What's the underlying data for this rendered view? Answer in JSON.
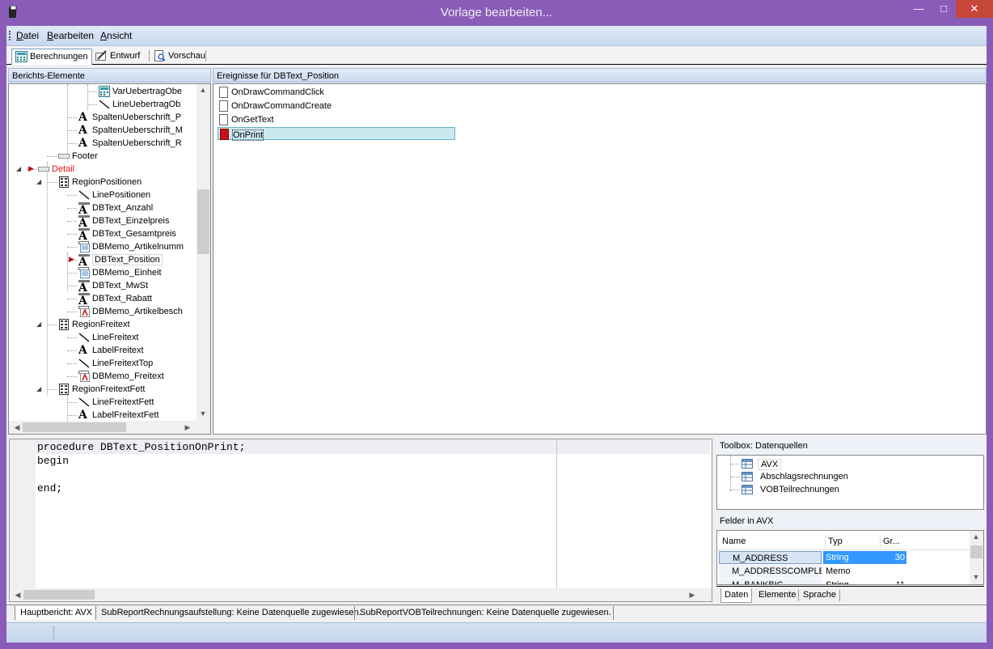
{
  "window": {
    "title": "Vorlage bearbeiten..."
  },
  "menu": [
    "Datei",
    "Bearbeiten",
    "Ansicht"
  ],
  "tabs": [
    {
      "label": "Berechnungen",
      "icon": "calculator-icon",
      "active": true
    },
    {
      "label": "Entwurf",
      "icon": "pencil-icon",
      "active": false
    },
    {
      "label": "Vorschau",
      "icon": "preview-icon",
      "active": false
    }
  ],
  "left_panel": {
    "header": "Berichts-Elemente",
    "tree": [
      {
        "label": "VarUebertragObe",
        "icon": "calc-icon",
        "level": 5
      },
      {
        "label": "LineUebertragOb",
        "icon": "line-icon",
        "level": 5
      },
      {
        "label": "SpaltenUeberschrift_P",
        "icon": "label-icon",
        "level": 4
      },
      {
        "label": "SpaltenUeberschrift_M",
        "icon": "label-icon",
        "level": 4
      },
      {
        "label": "SpaltenUeberschrift_R",
        "icon": "label-icon",
        "level": 4
      },
      {
        "label": "Footer",
        "icon": "band-icon",
        "level": 3
      },
      {
        "label": "Detail",
        "icon": "band-icon",
        "level": 2,
        "highlight": true
      },
      {
        "label": "RegionPositionen",
        "icon": "region-icon",
        "level": 3
      },
      {
        "label": "LinePositionen",
        "icon": "line-icon",
        "level": 4
      },
      {
        "label": "DBText_Anzahl",
        "icon": "dbtext-icon",
        "level": 4
      },
      {
        "label": "DBText_Einzelpreis",
        "icon": "dbtext-icon",
        "level": 4
      },
      {
        "label": "DBText_Gesamtpreis",
        "icon": "dbtext-icon",
        "level": 4
      },
      {
        "label": "DBMemo_Artikelnumm",
        "icon": "dbmemo-icon",
        "level": 4
      },
      {
        "label": "DBText_Position",
        "icon": "dbtext-icon",
        "level": 4,
        "selected": true
      },
      {
        "label": "DBMemo_Einheit",
        "icon": "dbmemo-icon",
        "level": 4
      },
      {
        "label": "DBText_MwSt",
        "icon": "dbtext-icon",
        "level": 4
      },
      {
        "label": "DBText_Rabatt",
        "icon": "dbtext-icon",
        "level": 4
      },
      {
        "label": "DBMemo_Artikelbesch",
        "icon": "dbrichtext-icon",
        "level": 4
      },
      {
        "label": "RegionFreitext",
        "icon": "region-icon",
        "level": 3
      },
      {
        "label": "LineFreitext",
        "icon": "line-icon",
        "level": 4
      },
      {
        "label": "LabelFreitext",
        "icon": "label-icon",
        "level": 4
      },
      {
        "label": "LineFreitextTop",
        "icon": "line-icon",
        "level": 4
      },
      {
        "label": "DBMemo_Freitext",
        "icon": "dbrichtext-icon",
        "level": 4
      },
      {
        "label": "RegionFreitextFett",
        "icon": "region-icon",
        "level": 3
      },
      {
        "label": "LineFreitextFett",
        "icon": "line-icon",
        "level": 4
      },
      {
        "label": "LabelFreitextFett",
        "icon": "label-icon",
        "level": 4
      }
    ]
  },
  "events_panel": {
    "header": "Ereignisse für DBText_Position",
    "events": [
      {
        "label": "OnDrawCommandClick",
        "active": false
      },
      {
        "label": "OnDrawCommandCreate",
        "active": false
      },
      {
        "label": "OnGetText",
        "active": false
      },
      {
        "label": "OnPrint",
        "active": true
      }
    ]
  },
  "code_editor": {
    "lines": [
      "procedure DBText_PositionOnPrint;",
      "begin",
      "",
      "end;"
    ]
  },
  "toolbox": {
    "header": "Toolbox: Datenquellen",
    "sources": [
      "AVX",
      "Abschlagsrechnungen",
      "VOBTeilrechnungen"
    ]
  },
  "fields": {
    "header": "Felder in AVX",
    "columns": [
      "Name",
      "Typ",
      "Gr..."
    ],
    "rows": [
      {
        "name": "M_ADDRESS",
        "type": "String",
        "size": "30",
        "selected": true
      },
      {
        "name": "M_ADDRESSCOMPLETE",
        "type": "Memo",
        "size": ""
      },
      {
        "name": "M_BANKBIC",
        "type": "String",
        "size": "11"
      }
    ],
    "tabs": [
      "Daten",
      "Elemente",
      "Sprache"
    ]
  },
  "status_tabs": [
    "Hauptbericht: AVX",
    "SubReportRechnungsaufstellung: Keine Datenquelle zugewiesen.",
    "SubReportVOBTeilrechnungen: Keine Datenquelle zugewiesen."
  ]
}
